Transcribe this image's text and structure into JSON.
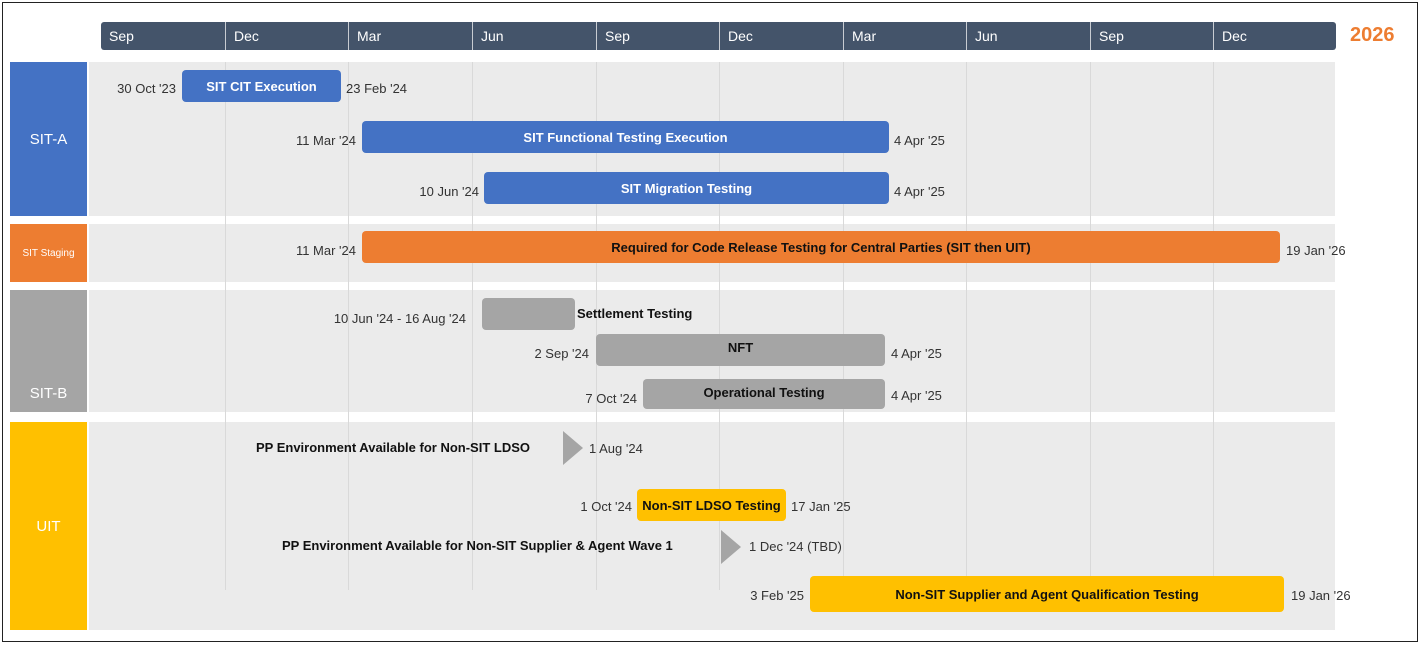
{
  "timeline": {
    "months": [
      "Sep",
      "Dec",
      "Mar",
      "Jun",
      "Sep",
      "Dec",
      "Mar",
      "Jun",
      "Sep",
      "Dec"
    ],
    "year_label": "2026"
  },
  "groups": [
    {
      "label": "SIT-A",
      "color": "#4472c4"
    },
    {
      "label": "SIT Staging",
      "color": "#ed7d31"
    },
    {
      "label": "SIT-B",
      "color": "#a5a5a5"
    },
    {
      "label": "UIT",
      "color": "#ffc000"
    }
  ],
  "chart_data": {
    "type": "gantt",
    "tasks": [
      {
        "group": "SIT-A",
        "name": "SIT CIT Execution",
        "start": "30 Oct '23",
        "end": "23 Feb '24",
        "color": "#4472c4"
      },
      {
        "group": "SIT-A",
        "name": "SIT Functional Testing Execution",
        "start": "11 Mar '24",
        "end": "4 Apr '25",
        "color": "#4472c4"
      },
      {
        "group": "SIT-A",
        "name": "SIT Migration Testing",
        "start": "10 Jun '24",
        "end": "4 Apr '25",
        "color": "#4472c4"
      },
      {
        "group": "SIT Staging",
        "name": "Required for Code Release Testing for Central Parties (SIT then UIT)",
        "start": "11 Mar '24",
        "end": "19 Jan '26",
        "color": "#ed7d31"
      },
      {
        "group": "SIT-B",
        "name": "Settlement Testing",
        "range": "10 Jun '24 - 16 Aug '24",
        "color": "#a5a5a5"
      },
      {
        "group": "SIT-B",
        "name": "NFT",
        "start": "2 Sep '24",
        "end": "4 Apr '25",
        "color": "#a5a5a5"
      },
      {
        "group": "SIT-B",
        "name": "Operational Testing",
        "start": "7 Oct '24",
        "end": "4 Apr '25",
        "color": "#a5a5a5"
      },
      {
        "group": "UIT",
        "name": "Non-SIT LDSO Testing",
        "start": "1 Oct '24",
        "end": "17 Jan '25",
        "color": "#ffc000"
      },
      {
        "group": "UIT",
        "name": "Non-SIT Supplier and Agent Qualification Testing",
        "start": "3 Feb '25",
        "end": "19 Jan '26",
        "color": "#ffc000"
      }
    ],
    "milestones": [
      {
        "group": "UIT",
        "name": "PP Environment Available for Non-SIT LDSO",
        "date": "1 Aug '24"
      },
      {
        "group": "UIT",
        "name": "PP Environment Available for Non-SIT Supplier & Agent Wave 1",
        "date": "1 Dec '24 (TBD)"
      }
    ]
  }
}
